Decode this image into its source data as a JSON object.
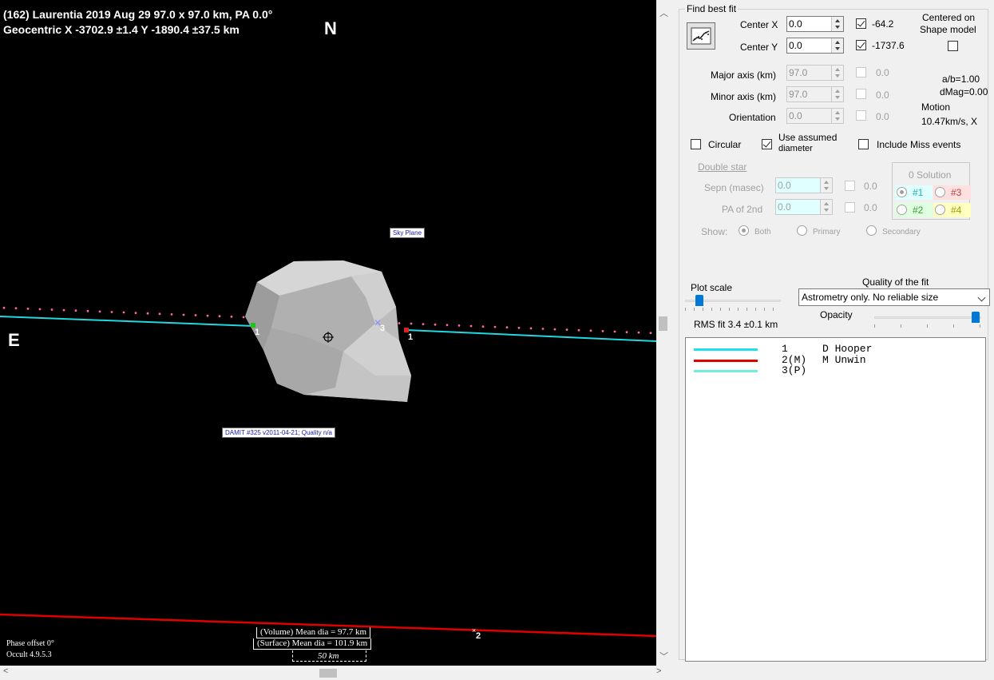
{
  "plot": {
    "header_line1": "(162) Laurentia  2019 Aug 29  97.0 x 97.0 km, PA 0.0°",
    "header_line2": "Geocentric  X  -3702.9 ±1.4  Y -1890.4 ±37.5 km",
    "north": "N",
    "east": "E",
    "sky_plane_label": "Sky Plane",
    "damit_label": "DAMIT #325 v2011-04-21; Quality n/a",
    "volume_dia": "(Volume) Mean dia = 97.7 km",
    "surface_dia": "(Surface) Mean dia = 101.9 km",
    "scale_label": "50 km",
    "phase_offset": "Phase offset 0°",
    "version": "Occult 4.9.5.3",
    "chord_labels": [
      "1",
      "3",
      "1",
      "2"
    ],
    "colors": {
      "background": "#000000",
      "chord1": "#20d8e0",
      "chord2": "#e00000",
      "dots": "#ff66aa",
      "shape": "#b8b8b8"
    }
  },
  "panel": {
    "group_title": "Find best fit",
    "center_x_label": "Center X",
    "center_x_value": "0.0",
    "center_x_fit": "-64.2",
    "center_y_label": "Center Y",
    "center_y_value": "0.0",
    "center_y_fit": "-1737.6",
    "centered_on": "Centered on",
    "shape_model": "Shape model",
    "major_axis_label": "Major axis (km)",
    "major_axis_value": "97.0",
    "major_axis_fit": "0.0",
    "minor_axis_label": "Minor axis (km)",
    "minor_axis_value": "97.0",
    "minor_axis_fit": "0.0",
    "orientation_label": "Orientation",
    "orientation_value": "0.0",
    "orientation_fit": "0.0",
    "ab_ratio": "a/b=1.00",
    "dmag": "dMag=0.00",
    "motion_label": "Motion",
    "motion_value": "10.47km/s, X",
    "circular_label": "Circular",
    "use_assumed_line1": "Use assumed",
    "use_assumed_line2": "diameter",
    "include_miss": "Include Miss events",
    "double_star": "Double star",
    "sepn_label": "Sepn (masec)",
    "sepn_value": "0.0",
    "sepn_fit": "0.0",
    "pa2_label": "PA of 2nd",
    "pa2_value": "0.0",
    "pa2_fit": "0.0",
    "solution_title": "0 Solution",
    "sol1": "#1",
    "sol2": "#2",
    "sol3": "#3",
    "sol4": "#4",
    "show_label": "Show:",
    "show_both": "Both",
    "show_primary": "Primary",
    "show_secondary": "Secondary",
    "plot_scale": "Plot scale",
    "quality_label": "Quality of the fit",
    "quality_value": "Astrometry only. No reliable size",
    "opacity_label": "Opacity",
    "rms_fit": "RMS fit 3.4 ±0.1 km",
    "plot_scale_level": 0.12,
    "opacity_level": 0.98
  },
  "legend": [
    {
      "id": "1",
      "name": "D Hooper",
      "color": "#20e0f0"
    },
    {
      "id": "2(M)",
      "name": "M Unwin",
      "color": "#e00000"
    },
    {
      "id": "3(P)",
      "name": "",
      "color": "#70f0d8"
    }
  ]
}
